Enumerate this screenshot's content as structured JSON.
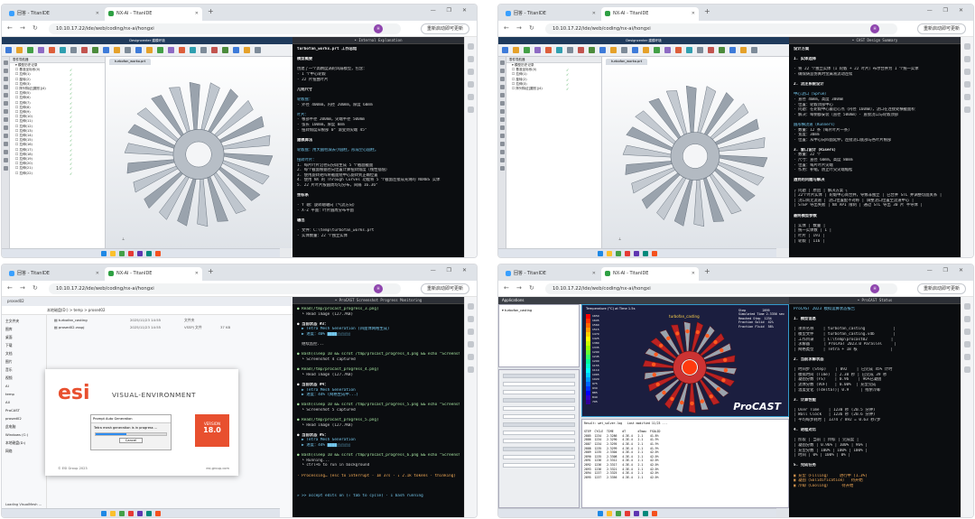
{
  "browser": {
    "tabs": [
      "回答 - TitanIDE",
      "NX-AI - TitanIDE"
    ],
    "address": "10.10.17.22/ide/web/coding/nx-ai/hongxi",
    "profile_initial": "H",
    "reload_button": "重新启动即可更新"
  },
  "colors": {
    "terminal_bg": "#0b0d10",
    "accent_cyan": "#74c7ec",
    "brand_orange": "#e8502f"
  },
  "q1": {
    "cad_title": "Designcenter 建模环境",
    "tree_head": "零件导航器",
    "tree_items": [
      "模型历史记录",
      "基准坐标系(0)",
      "拉伸(1)",
      "旋转(2)",
      "拉伸(3)",
      "阵列特征[圆形](4)",
      "拉伸(5)",
      "拉伸(6)",
      "拉伸(7)",
      "拉伸(8)",
      "拉伸(9)",
      "拉伸(10)",
      "拉伸(11)",
      "拉伸(12)",
      "拉伸(13)",
      "拉伸(14)",
      "拉伸(15)",
      "拉伸(16)",
      "拉伸(17)",
      "拉伸(18)",
      "拉伸(19)",
      "拉伸(20)",
      "拉伸(21)",
      "拉伸(22)"
    ],
    "view_tab": "turbofan_worko.prt",
    "term_header": "• Internal Explanation",
    "term_lines": [
      "turbofan_works.prt 工作总结",
      "",
      "模型概要",
      "",
      "创建了一个高精度涡轮风扇模型，包含：",
      "- 1 个中心轮毂",
      "- 22 片扭曲叶片",
      "",
      "几何尺寸",
      "",
      "轮毂盘：",
      "- 外径 400mm，内径 200mm，厚度 60mm",
      "",
      "叶片：",
      "- 根部半径 200mm，尖端半径 500mm",
      "- 弦长 100mm，厚度 8mm",
      "- 扭转角度从根部 0° 渐变到尖端 45°",
      "",
      "建模算法",
      "",
      "轮毂盘：用大圆柱减去小圆柱，形成空心圆柱。",
      "",
      "扭转叶片：",
      "1. 每片叶片沿径向分段生成 5 个截面截面",
      "2. 每个截面根据径向位置计算扭转角度（线性插值）",
      "3. 使用旋转矩阵将截面绕中心旋转到正确位置",
      "4. 使用 NX 的 Through Curves 功能将 5 个截面连接成光滑的 NURBS 实体",
      "5. 22 片叶片按圆周均匀分布，间隔 16.36°",
      "",
      "坐标系",
      "",
      "- Y 轴：旋转轴轴向（气流方向）",
      "- X-Z 平面：叶片圆周分布平面",
      "",
      "输出",
      "",
      "- 文件：C:\\temp\\turbofan_works.prt",
      "- 实体数量：22 个独立实体"
    ]
  },
  "q2": {
    "term_header": "• CAST Design Summary",
    "term_lines": [
      "设计方案",
      "",
      "1. 实体选择",
      "",
      "· 将 22 个独立实体（1 轮毂 + 22 叶片）布尔合并为 1 个统一实体",
      "· 确保铸造仿真时金属液流动连续",
      "",
      "2. 浇注系统设计",
      "",
      "中心浇口（Sprue）",
      "· 直径 40mm，高度 300mm",
      "· 位置：轮毂顶部中心",
      "· 问题：在轮毂中心最近心点（内径 160mm），浇口在连接处横截面积",
      "· 解决：每侧都安装（直径 500mm）- 直接浇口与轮毂顶部",
      "",
      "圆形横浇道（Runners）",
      "· 数量：12 条（每片叶片一条）",
      "· 宽度：30mm",
      "· 位置：从中心向四面延伸，连接浇口底部与各叶片根部",
      "",
      "3. 冒口设计（Risers）",
      "· 数量：22 个",
      "· 尺寸：直径 60mm，高度 80mm",
      "· 位置：每片叶片尖端",
      "· 作用：补缩，防止叶尖尖端缩松",
      "",
      "遇到的问题与解决",
      "",
      "┌ 问题 │ 原因 │ 解决方案 ┐",
      "│ 22个叶片实体 │ 轮毂中心尚合并，导致非独立 │ 已合并 STL 并调整切面关系 │",
      "│ 浇口尚无流道 │ 浇口位置配不对称 │ 调整浇口位置至流道中心 │",
      "│ STEP 导出失败 │ NX API 限制 │ 通过 STL 导出 30 片 半导体 │",
      "",
      "最终模型参数",
      "",
      "│ 实体 │ 数量 │",
      "│ 统一实体数 │ 1 │",
      "│ 叶片 │ 191 │",
      "│ 轮毂 │ 116 │"
    ]
  },
  "q3": {
    "explorer_title": "prosed02",
    "explorer_path": "本地磁盘(D:) > temp > prosed02",
    "files": [
      {
        "name": "turbofan_casting",
        "date": "2025/11/23 14:55",
        "type": "文件夹",
        "size": ""
      },
      {
        "name": "prosed02.vsspj",
        "date": "2025/11/23 14:55",
        "type": "VSSPJ 文件",
        "size": "37 KB"
      }
    ],
    "sidebar_items": [
      "主文件夹",
      "图库",
      "桌面",
      "下载",
      "文档",
      "图片",
      "音乐",
      "视频",
      "AI",
      "temp",
      "AIl",
      "ProCAST",
      "prosed02",
      "此电脑",
      "Windows (C:)",
      "本地磁盘(D:)",
      "网络"
    ],
    "splash_brand": "VISUAL-ENVIRONMENT",
    "splash_logo": "esi",
    "splash_version_label": "VERSION",
    "splash_version": "18.0",
    "splash_copyright": "© ESI Group 2023",
    "splash_site": "esi-group.com",
    "dialog_title": "Prompt Auto Generation",
    "dialog_msg": "Tetra mesh generation is in progress ...",
    "dialog_cancel": "Cancel",
    "status_left": "Loading VisualMesh ...",
    "term_header": "• ProCAST Screenshot Progress Monitoring",
    "term_lines": [
      "● Read(/tmp/procast_progress_3.png)",
      "  └ Read image (127.7KB)",
      "",
      "● 当前状态 #3：",
      "  ▶ Tetra Mesh Generation (四面体网格生成)",
      "  ▶ 进度：40% ████░░░░░░",
      "",
      "  继续监控...",
      "",
      "● Bash(sleep 10 && scrot /tmp/procast_progress_4.png && echo \"Screenshot 4 captured\")",
      "  └ Screenshot 4 captured",
      "",
      "● Read(/tmp/procast_progress_4.png)",
      "  └ Read image (127.7KB)",
      "",
      "● 当前状态 #4：",
      "  ▶ Tetra Mesh Generation",
      "  ▶ 进度：44% (网格生成中...)",
      "",
      "● Bash(sleep 10 && scrot /tmp/procast_progress_5.png && echo \"Screenshot 5 captured\")",
      "  └ Screenshot 5 captured",
      "",
      "● Read(/tmp/procast_progress_5.png)",
      "  └ Read image (127.7KB)",
      "",
      "● 当前状态 #5：",
      "  ▶ Tetra Mesh Generation",
      "  ▶ 进度：44% ████░░░░░░",
      "",
      "● Bash(sleep 10 && scrot /tmp/procast_progress_6.png && echo \"Screenshot 6 captured\")",
      "  └ Running...",
      "  └ ctrl+b to run in background",
      "",
      "· Processing… (esc to interrupt · 1m 37s · ↓ 2.1k tokens · thinking)",
      "",
      "",
      "",
      "» >> accept edits on (⇧ tab to cycle) · 1 bash running"
    ]
  },
  "q4": {
    "app_menu": "Applications",
    "result_header": "Temperature (°C) at Time 1.5s",
    "view_title": "turbofan_casting",
    "stats": [
      "Step         2895",
      "Simulated Time 2.3356 sec",
      "Reached Step  1234",
      "Fraction Solid  42%",
      "Fraction Fluid  58%"
    ],
    "brand": "ProCAST",
    "legend_values": [
      "1650",
      "1605",
      "1560",
      "1515",
      "1470",
      "1425",
      "1380",
      "1335",
      "1290",
      "1245",
      "1200",
      "1155",
      "1110",
      "1065",
      "1020",
      "975",
      "930",
      "885",
      "840",
      "795"
    ],
    "log_lines": [
      "Result: wet_solver.log   Last modified 11/23 ...",
      "  ",
      "STEP  CYCLE  TIME     dT       dTmax  FSOLID",
      "2885  1234   2.3286   4.3E-4   2.1    41.8%",
      "2886  1234   2.3290   4.3E-4   2.1    41.9%",
      "2887  1234   2.3295   4.3E-4   2.1    41.9%",
      "2888  1235   2.3299   4.3E-4   2.1    41.9%",
      "2889  1235   2.3304   4.3E-4   2.1    42.0%",
      "2890  1235   2.3308   4.3E-4   2.1    42.0%",
      "2891  1236   2.3312   4.3E-4   2.1    42.0%",
      "2892  1236   2.3317   4.3E-4   2.1    42.0%",
      "2893  1236   2.3321   4.3E-4   2.1    42.0%",
      "2894  1237   2.3325   4.3E-4   2.1    42.0%",
      "2895  1237   2.3356   4.3E-4   2.1    42.0%"
    ],
    "term_header": "• ProCAST Status",
    "term_lines": [
      "ProCAST 2023 模拟运算状态报告",
      "",
      "1. 模型信息",
      "",
      "│ 项目名称    │ turbofan_casting            │",
      "│ 模型文件    │ turbofan_casting.vdb        │",
      "│ 工作目录    │ C:\\temp\\procast02          │",
      "│ 求解器      │ ProCAST 2023.0 Parallel     │",
      "│ 网格类型    │ Tetra + 18 核              │",
      "",
      "2. 当前求解状态",
      "",
      "│ 时间步 (Step)    │ 892    │ 已完成 45% 计时",
      "│ 模拟时间 (Time)  │ 2.30 秒 │ 已完成 39 秒",
      "│ 凝固分数 (FS)    │ 0.96    │ 96%已凝固",
      "│ 流体分数 (VOF)   │ 0.00%  │ 充型完成",
      "│ 温度变化 (TdeltaT)│ 0.9     │ 残余冷却",
      "",
      "3. 计算性能",
      "",
      "│ User Time    │ 1230 秒 (20.5 分钟)",
      "│ Wall Clock   │ 1236 秒 (20.6 分钟)",
      "│ 平均每步耗时 │ 1374 / 892 = 0.63 秒/步",
      "",
      "4. 进程对比",
      "",
      "│ 阶段 │ 当前 │ 目标 │ 完成度 │",
      "│ 凝固分数 │ 0.96% │ 100% │ 96% │",
      "│ 充型分数 │ 100% │ 100% │ 100% │",
      "│ 时间 │ 0% │ 100% │ 0% │",
      "",
      "5. 完成任务",
      "",
      "▣ 充型（Filling）    进行中 (1.3%)",
      "▣ 凝固（Solidification）  待开始",
      "▣ 冷却（Cooling）     待开始"
    ]
  }
}
